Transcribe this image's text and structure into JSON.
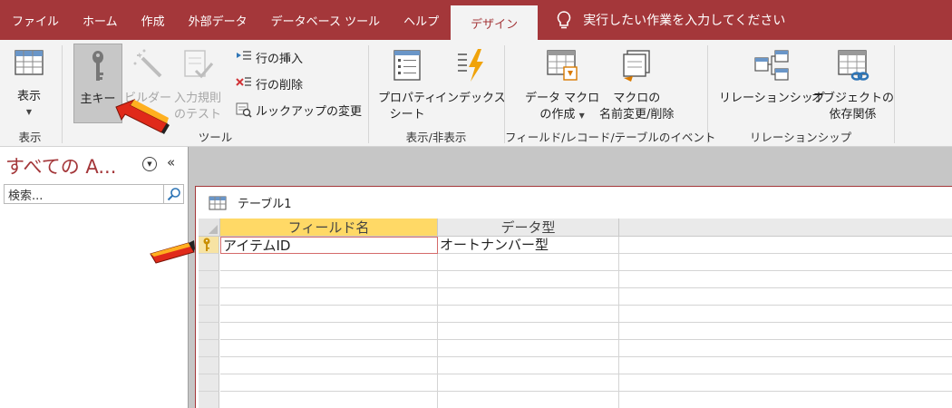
{
  "tabs": [
    "ファイル",
    "ホーム",
    "作成",
    "外部データ",
    "データベース ツール",
    "ヘルプ"
  ],
  "active_tab": "デザイン",
  "tell_me": "実行したい作業を入力してください",
  "ribbon": {
    "view": {
      "label": "表示",
      "group": "表示"
    },
    "tools": {
      "primary_key": "主キー",
      "builder": "ビルダー",
      "test_rule_line1": "入力規則",
      "test_rule_line2": "のテスト",
      "insert_rows": "行の挿入",
      "delete_rows": "行の削除",
      "modify_lookups": "ルックアップの変更",
      "group": "ツール"
    },
    "show_hide": {
      "property_line1": "プロパティ",
      "property_line2": "シート",
      "indexes": "インデックス",
      "group": "表示/非表示"
    },
    "events": {
      "data_macro_line1": "データ マクロ",
      "data_macro_line2": "の作成",
      "rename_macro_line1": "マクロの",
      "rename_macro_line2": "名前変更/削除",
      "group": "フィールド/レコード/テーブルのイベント"
    },
    "relationships": {
      "relationships": "リレーションシップ",
      "dependencies_line1": "オブジェクトの",
      "dependencies_line2": "依存関係",
      "group": "リレーションシップ"
    }
  },
  "nav": {
    "title": "すべての A...",
    "search_placeholder": "検索..."
  },
  "document": {
    "tab_title": "テーブル1",
    "columns": [
      "フィールド名",
      "データ型"
    ],
    "rows": [
      {
        "field_name": "アイテムID",
        "data_type": "オートナンバー型"
      }
    ]
  },
  "colors": {
    "accent": "#a4373a",
    "header_highlight": "#ffd966",
    "pointer_red": "#e02a1a",
    "pointer_orange": "#ffb020"
  }
}
